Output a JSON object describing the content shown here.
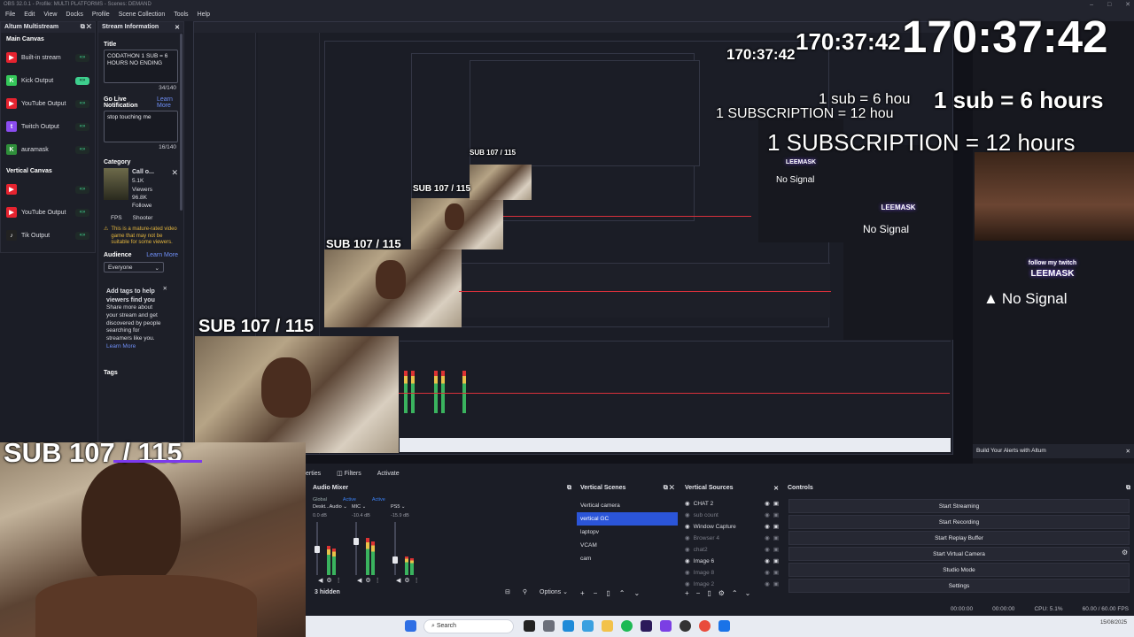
{
  "window": {
    "title": "OBS 32.0.1 - Profile: MULTI PLATFORMS - Scenes: DEMAND",
    "controls": [
      "–",
      "□",
      "✕"
    ]
  },
  "menu": [
    "File",
    "Edit",
    "View",
    "Docks",
    "Profile",
    "Scene Collection",
    "Tools",
    "Help"
  ],
  "multistream": {
    "title": "Altum Multistream",
    "main_canvas": "Main Canvas",
    "main_items": [
      {
        "label": "Built-in stream",
        "color": "#e6232f",
        "glyph": "▶",
        "toggle": "«»"
      },
      {
        "label": "Kick Output",
        "color": "#35c85a",
        "glyph": "K",
        "toggle": "«»"
      },
      {
        "label": "YouTube Output",
        "color": "#e6232f",
        "glyph": "▶",
        "toggle": "«»"
      },
      {
        "label": "Twitch Output",
        "color": "#8b4cf0",
        "glyph": "t",
        "toggle": "«»"
      },
      {
        "label": "auramask",
        "color": "#2f8f3a",
        "glyph": "K",
        "toggle": "«»"
      }
    ],
    "vertical_canvas": "Vertical Canvas",
    "vertical_items": [
      {
        "label": "",
        "color": "#e6232f",
        "glyph": "▶",
        "toggle": "«»"
      },
      {
        "label": "YouTube Output",
        "color": "#e6232f",
        "glyph": "▶",
        "toggle": "«»"
      },
      {
        "label": "Tik Output",
        "color": "#222",
        "glyph": "♪",
        "toggle": "«»"
      }
    ]
  },
  "stream_info": {
    "title": "Stream Information",
    "title_label": "Title",
    "title_value": "CODATHON 1 SUB = 6 HOURS NO ENDING",
    "title_count": "34/140",
    "golive_label": "Go Live Notification",
    "learn_more": "Learn More",
    "golive_value": "stop touching me",
    "golive_count": "16/140",
    "category_label": "Category",
    "category_name": "Call o...",
    "viewers": "5.1K",
    "viewers_label": "Viewers",
    "followers": "96.8K",
    "followers_label": "Followe",
    "tags": [
      "FPS",
      "Shooter"
    ],
    "warning": "This is a mature-rated video game that may not be suitable for some viewers.",
    "audience_label": "Audience",
    "audience_value": "Everyone",
    "tags_help_title": "Add tags to help viewers find you",
    "tags_help_body": "Share more about your stream and get discovered by people searching for streamers like you.",
    "tags_label": "Tags"
  },
  "preview": {
    "big_timer": "170:37:42",
    "timer_2": "170:37:42",
    "timer_3": "170:37:42",
    "sub_line": "1 sub = 6 hours",
    "sub_line_short": "1 sub = 6 hou",
    "subscription_line": "1 SUBSCRIPTION = 12 hours",
    "subscription_short": "1 SUBSCRIPTION = 12 hou",
    "sub_counter": "SUB 107 / 115",
    "no_signal": "No Signal",
    "follow_text": "follow my twitch",
    "leemask": "LEEMASK",
    "alerts_text": "Build Your Alerts with Altum"
  },
  "audio_mixer": {
    "title": "Audio Mixer",
    "tabs": [
      "Global",
      "Active",
      "Active"
    ],
    "channels": [
      {
        "name": "Deskt...Audio",
        "db": "0.0 dB",
        "level": 0.55
      },
      {
        "name": "MIC",
        "db": "-10.4 dB",
        "level": 0.7
      },
      {
        "name": "PS5",
        "db": "-15.9 dB",
        "level": 0.35
      }
    ],
    "hidden": "3 hidden",
    "options": "Options"
  },
  "scenes": {
    "title": "Vertical Scenes",
    "items": [
      "Vertical camera",
      "vertical GC",
      "laptopv",
      "VCAM",
      "cam"
    ],
    "selected": 1
  },
  "sources": {
    "title": "Vertical Sources",
    "items": [
      {
        "label": "CHAT 2",
        "visible": true
      },
      {
        "label": "sub count",
        "visible": false
      },
      {
        "label": "Window Capture",
        "visible": true
      },
      {
        "label": "Browser 4",
        "visible": false
      },
      {
        "label": "chat2",
        "visible": false
      },
      {
        "label": "Image 6",
        "visible": true
      },
      {
        "label": "Image 8",
        "visible": false
      },
      {
        "label": "Image 2",
        "visible": false
      }
    ]
  },
  "controls": {
    "title": "Controls",
    "buttons": [
      "Start Streaming",
      "Start Recording",
      "Start Replay Buffer",
      "Start Virtual Camera",
      "Studio Mode",
      "Settings"
    ]
  },
  "tab_partial": "erties",
  "filters_label": "Filters",
  "activate_label": "Activate",
  "status": {
    "time1": "00:00:00",
    "time2": "00:00:00",
    "cpu": "CPU: 5.1%",
    "fps": "60.00 / 60.00 FPS"
  },
  "taskbar": {
    "search_placeholder": "Search",
    "clock": "15/08/2025"
  }
}
